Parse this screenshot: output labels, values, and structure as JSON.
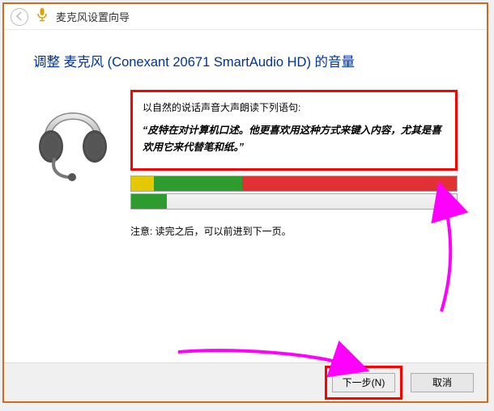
{
  "titlebar": {
    "title": "麦克风设置向导",
    "back_icon": "back-icon",
    "mic_icon": "microphone-icon"
  },
  "page": {
    "heading": "调整 麦克风 (Conexant 20671 SmartAudio HD) 的音量"
  },
  "reading": {
    "prompt": "以自然的说话声音大声朗读下列语句:",
    "quote": "“皮特在对计算机口述。他更喜欢用这种方式来键入内容，尤其是喜欢用它来代替笔和纸。”"
  },
  "level_meter": {
    "segments": [
      {
        "color": "#e5c900",
        "width_pct": 7
      },
      {
        "color": "#2e9b2e",
        "width_pct": 27
      },
      {
        "color": "#e03232",
        "width_pct": 66
      }
    ]
  },
  "fill_meter": {
    "fill_pct": 11,
    "fill_color": "#2e9b2e"
  },
  "note": "注意: 读完之后，可以前进到下一页。",
  "buttons": {
    "next": "下一步(N)",
    "cancel": "取消"
  },
  "annotation_arrows": {
    "color": "#ff00ff"
  }
}
